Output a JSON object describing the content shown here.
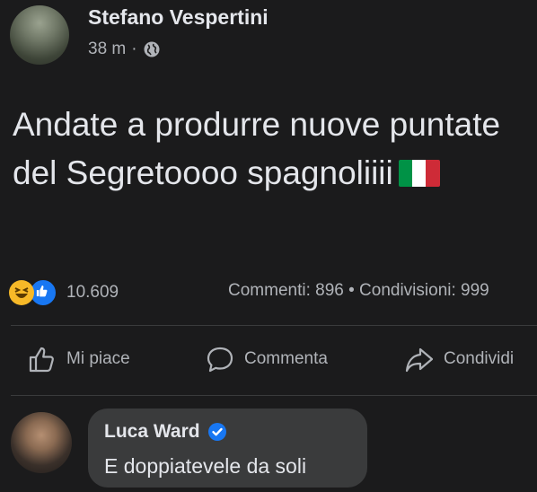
{
  "post": {
    "author": "Stefano Vespertini",
    "time": "38 m",
    "separator": "·",
    "privacy_icon": "globe-icon",
    "text": "Andate a produrre nuove puntate del Segretoooo spagnoliiii",
    "flag_colors": [
      "#009246",
      "#ffffff",
      "#ce2b37"
    ]
  },
  "reactions": {
    "icons": [
      "haha-reaction-icon",
      "like-reaction-icon"
    ],
    "count": "10.609",
    "stats": "Commenti: 896 • Condivisioni: 999"
  },
  "actions": [
    {
      "label": "Mi piace",
      "icon": "thumbs-up-icon"
    },
    {
      "label": "Commenta",
      "icon": "comment-icon"
    },
    {
      "label": "Condividi",
      "icon": "share-icon"
    }
  ],
  "comment": {
    "author": "Luca Ward",
    "verified_icon": "verified-badge-icon",
    "text": "E doppiatevele da soli"
  },
  "colors": {
    "background": "#1b1b1c",
    "text_primary": "#e4e6eb",
    "text_secondary": "#b0b3b8",
    "like_blue": "#1877f2",
    "haha_yellow": "#f7b928",
    "comment_bubble": "#3a3b3c"
  }
}
